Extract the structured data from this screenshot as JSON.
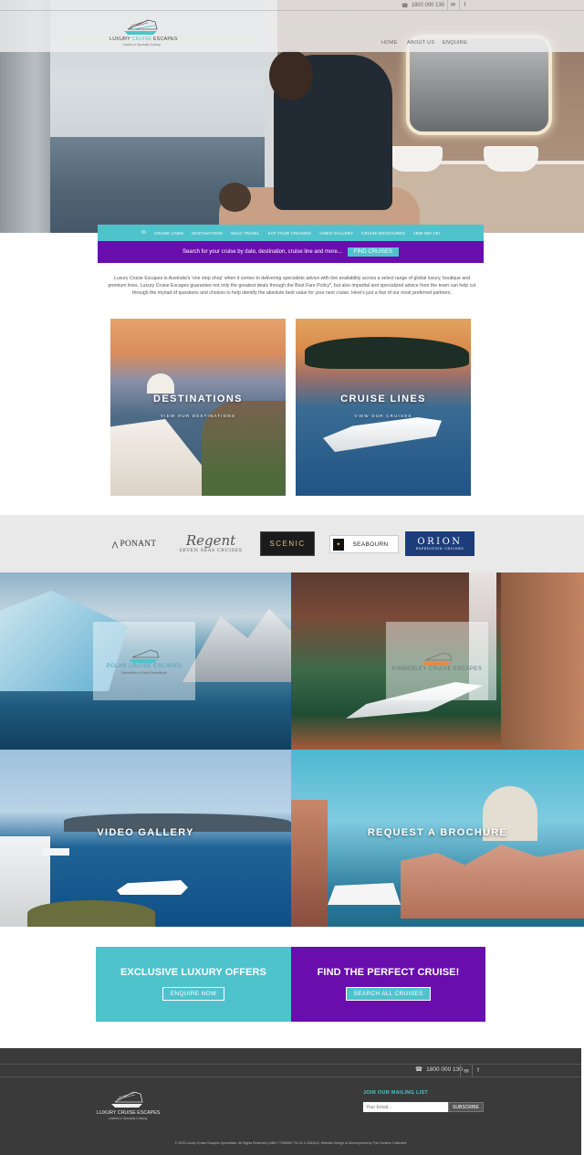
{
  "topbar": {
    "phone": "1800 000 130",
    "icons": [
      "email-icon",
      "facebook-icon"
    ]
  },
  "logo": {
    "name_part1": "LUXURY",
    "name_accent": "CRUISE",
    "name_part2": "ESCAPES",
    "tagline": "Leaders in Specialty Cruising"
  },
  "nav": {
    "home": "HOME",
    "about": "ABOUT US",
    "enquire": "ENQUIRE"
  },
  "subnav": {
    "items": [
      "CRUISE LINES",
      "DESTINATIONS",
      "SOLO TRAVEL",
      "KAP YOUR CRUISING",
      "VIDEO GALLERY",
      "CRUISE BROCHURES",
      "1800 000 130"
    ]
  },
  "search": {
    "text": "Search for your cruise by date, destination, cruise line and more...",
    "button": "FIND CRUISES"
  },
  "intro": {
    "text": "Luxury Cruise Escapes is Australia's 'one stop shop' when it comes to delivering specialists advice with live availability across a select range of global luxury, boutique and premium lines. Luxury Cruise Escapes guarantee not only the greatest deals through the Best Fare Policy*, but also impartial and specialized advice from the team can help cut through the myriad of questions and choices to help identify the absolute best value for your next cruise. Here's just a few of our most preferred partners."
  },
  "tiles": {
    "destinations": {
      "title": "DESTINATIONS",
      "sub": "VIEW OUR DESTINATIONS"
    },
    "cruise_lines": {
      "title": "CRUISE LINES",
      "sub": "VIEW OUR CRUISES"
    }
  },
  "partners": {
    "ponant": "PONANT",
    "regent": "Regent",
    "regent_sub": "SEVEN SEAS CRUISES",
    "scenic": "SCENIC",
    "seabourn": "SEABOURN",
    "orion": "ORION",
    "orion_sub": "EXPEDITION CRUISES"
  },
  "promo": {
    "polar": {
      "name": "POLAR CRUISE ESCAPES",
      "tagline": "Specialists in Polar Expeditions"
    },
    "kimberley": {
      "name": "KIMBERLEY CRUISE ESCAPES",
      "tagline": ""
    },
    "video": {
      "title": "VIDEO GALLERY"
    },
    "brochure": {
      "title": "REQUEST A BROCHURE"
    }
  },
  "cta": {
    "left": {
      "title": "EXCLUSIVE LUXURY OFFERS",
      "button": "ENQUIRE NOW"
    },
    "right": {
      "title": "FIND THE PERFECT CRUISE!",
      "button": "SEARCH ALL CRUISES"
    }
  },
  "footer": {
    "phone": "1800 000 130",
    "mailing_title": "JOIN OUR MAILING LIST",
    "email_placeholder": "Your Email...",
    "subscribe": "SUBSCRIBE",
    "copyright": "© 2020 Luxury Cruise Escapes Specialists. All Rights Reserved | ABN: 77598987 TA LIC # 3363AS | Website Design & Development by The Creative Collective"
  },
  "colors": {
    "teal": "#4fc3cc",
    "purple": "#6a0dad",
    "footer": "#3a3a3a"
  }
}
